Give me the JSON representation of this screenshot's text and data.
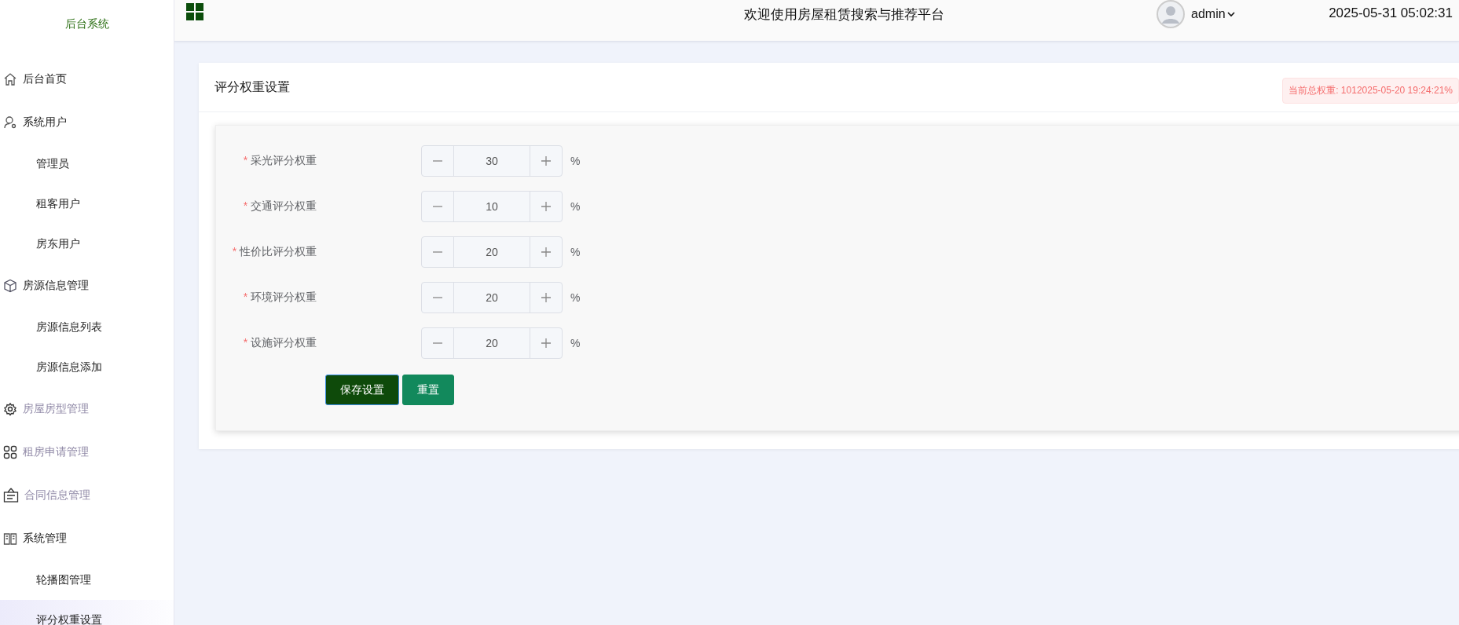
{
  "sidebar": {
    "title": "后台系统",
    "items": [
      {
        "label": "后台首页",
        "selected": false,
        "disabled": false
      },
      {
        "label": "系统用户",
        "selected": false,
        "disabled": false,
        "children": [
          {
            "label": "管理员",
            "selected": false
          },
          {
            "label": "租客用户",
            "selected": false
          },
          {
            "label": "房东用户",
            "selected": false
          }
        ]
      },
      {
        "label": "房源信息管理",
        "selected": false,
        "disabled": false,
        "children": [
          {
            "label": "房源信息列表",
            "selected": false
          },
          {
            "label": "房源信息添加",
            "selected": false
          }
        ]
      },
      {
        "label": "房屋房型管理",
        "selected": false,
        "disabled": true
      },
      {
        "label": "租房申请管理",
        "selected": false,
        "disabled": true
      },
      {
        "label": "合同信息管理",
        "selected": false,
        "disabled": true
      },
      {
        "label": "系统管理",
        "selected": false,
        "disabled": false,
        "children": [
          {
            "label": "轮播图管理",
            "selected": false
          },
          {
            "label": "评分权重设置",
            "selected": true
          }
        ]
      }
    ]
  },
  "header": {
    "title": "欢迎使用房屋租赁搜索与推荐平台",
    "user": "admin",
    "datetime": "2025-05-31 05:02:31"
  },
  "card": {
    "title": "评分权重设置",
    "notice": "当前总权重: 1012025-05-20 19:24:21%",
    "fields": [
      {
        "label": "采光评分权重",
        "required_mark": "*",
        "value": "30",
        "unit": "%"
      },
      {
        "label": "交通评分权重",
        "required_mark": "*",
        "value": "10",
        "unit": "%"
      },
      {
        "label": "性价比评分权重",
        "required_mark": "*",
        "value": "20",
        "unit": "%"
      },
      {
        "label": "环境评分权重",
        "required_mark": "*",
        "value": "20",
        "unit": "%"
      },
      {
        "label": "设施评分权重",
        "required_mark": "*",
        "value": "20",
        "unit": "%"
      }
    ],
    "buttons": [
      {
        "label": "保存设置",
        "kind": "primary"
      },
      {
        "label": "重置",
        "kind": "secondary"
      }
    ]
  }
}
